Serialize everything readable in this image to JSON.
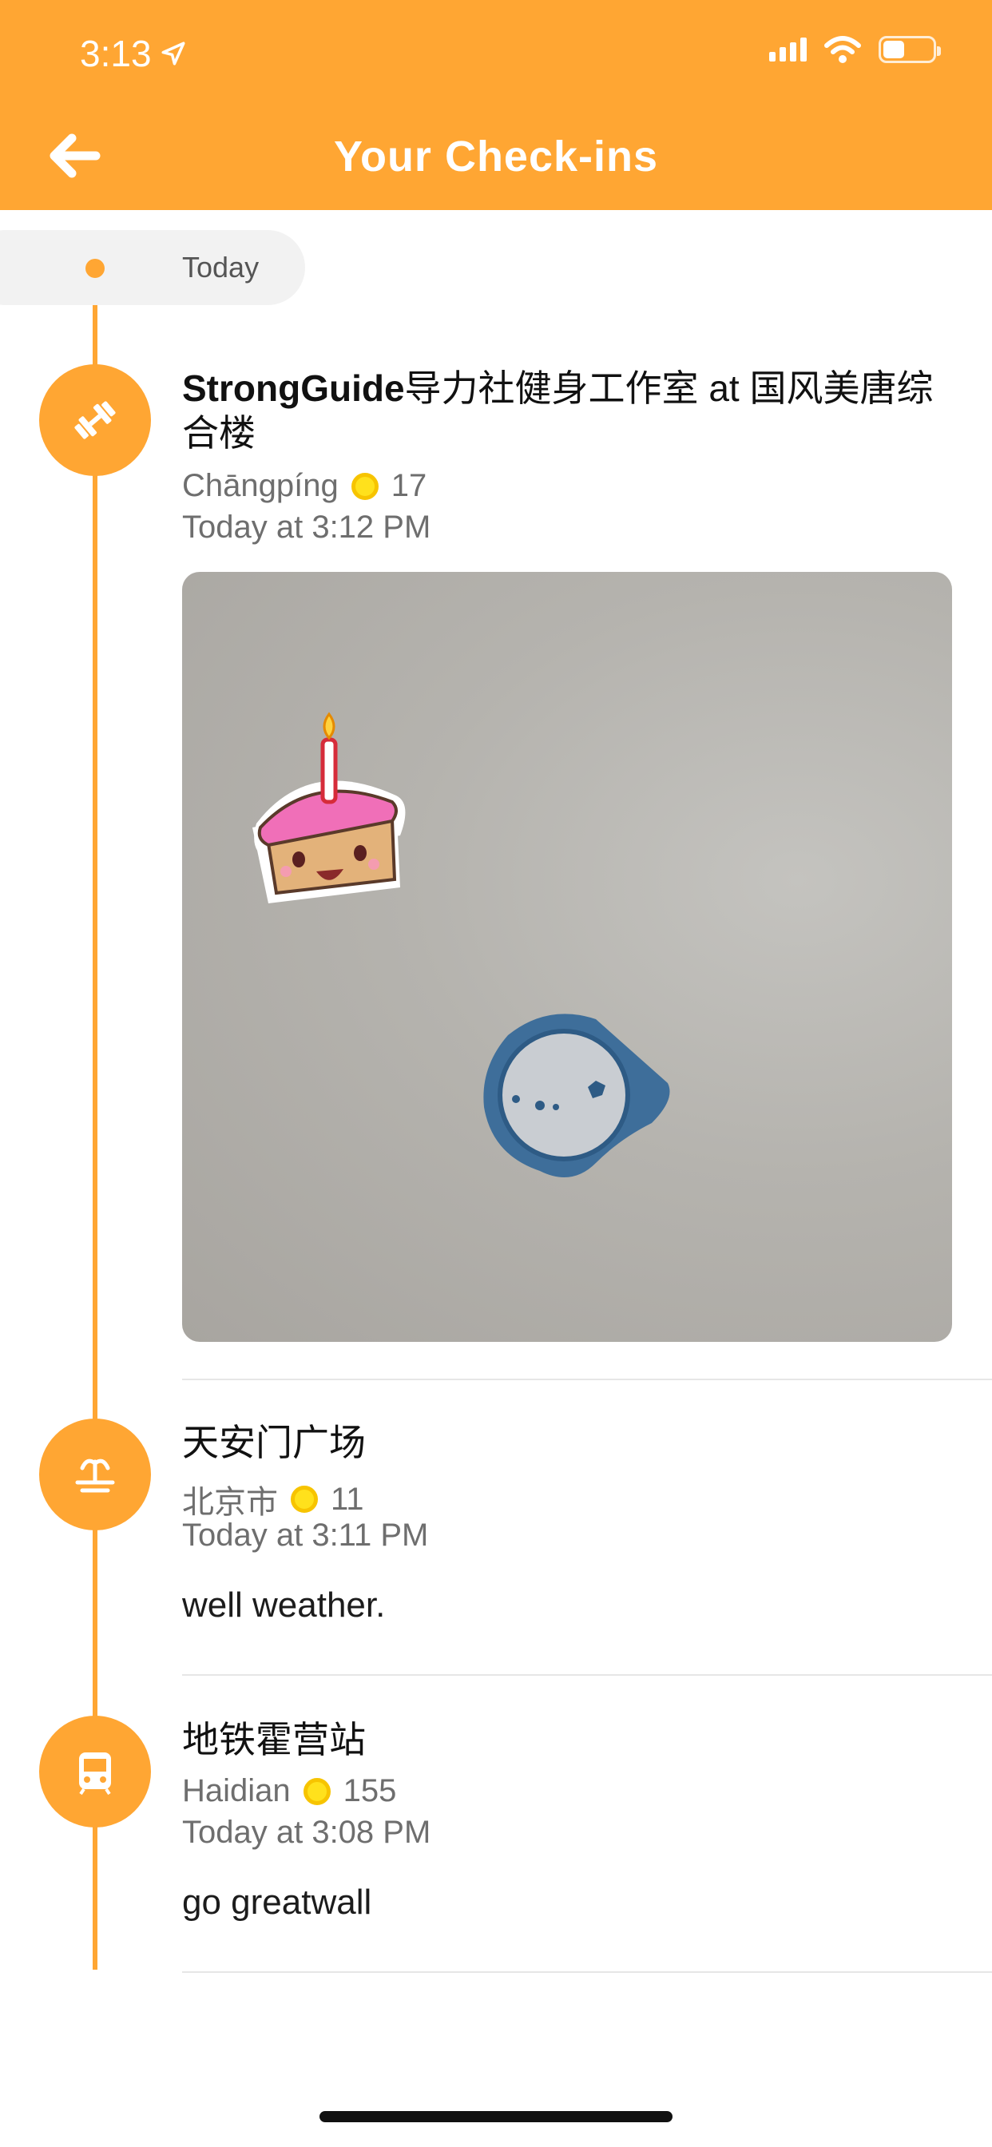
{
  "status_bar": {
    "time": "3:13"
  },
  "header": {
    "title": "Your Check-ins"
  },
  "timeline": {
    "date_label": "Today"
  },
  "checkins": [
    {
      "venue_bold": "StrongGuide",
      "venue_rest": "导力社健身工作室 at 国风美唐综合楼",
      "location": "Chāngpíng",
      "coins": "17",
      "time": "Today at 3:12 PM",
      "icon": "dumbbell-icon"
    },
    {
      "venue": "天安门广场",
      "location": "北京市",
      "coins": "11",
      "time": "Today at 3:11 PM",
      "shout": "well weather.",
      "icon": "fountain-icon"
    },
    {
      "venue": "地铁霍营站",
      "location": "Haidian",
      "coins": "155",
      "time": "Today at 3:08 PM",
      "shout": "go greatwall",
      "icon": "metro-train-icon"
    }
  ],
  "colors": {
    "accent": "#FFA633",
    "coin": "#FFE11C"
  }
}
